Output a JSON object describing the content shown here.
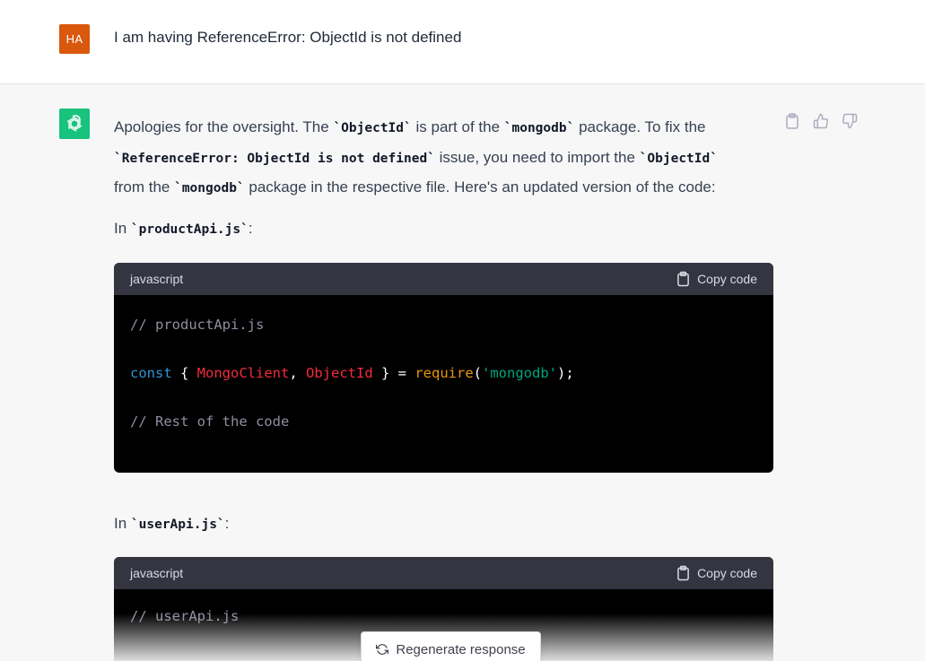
{
  "user": {
    "avatar_initials": "HA",
    "avatar_color": "#d9580d",
    "message": "I am having ReferenceError: ObjectId is not defined"
  },
  "assistant": {
    "avatar_color": "#19c37d",
    "intro": {
      "t1": "Apologies for the oversight. The ",
      "c1": "`ObjectId`",
      "t2": " is part of the ",
      "c2": "`mongodb`",
      "t3": " package. To fix the ",
      "c3": "`ReferenceError: ObjectId is not defined`",
      "t4": " issue, you need to import the ",
      "c4": "`ObjectId`",
      "t5": " from the ",
      "c5": "`mongodb`",
      "t6": " package in the respective file. Here's an updated version of the code:"
    },
    "section1": {
      "prefix": "In ",
      "file": "`productApi.js`",
      "suffix": ":"
    },
    "code1": {
      "language": "javascript",
      "copy_label": "Copy code",
      "line1_comment": "// productApi.js",
      "line2": {
        "kw": "const",
        "open": " { ",
        "cls1": "MongoClient",
        "comma": ", ",
        "cls2": "ObjectId",
        "close": " } = ",
        "fn": "require",
        "paren_open": "(",
        "str": "'mongodb'",
        "paren_close": ");"
      },
      "line3_comment": "// Rest of the code"
    },
    "section2": {
      "prefix": "In ",
      "file": "`userApi.js`",
      "suffix": ":"
    },
    "code2": {
      "language": "javascript",
      "copy_label": "Copy code",
      "line1_comment": "// userApi.js"
    }
  },
  "regenerate_label": "Regenerate response",
  "icons": [
    "clipboard-icon",
    "thumbs-up-icon",
    "thumbs-down-icon",
    "openai-logo-icon",
    "refresh-icon"
  ]
}
